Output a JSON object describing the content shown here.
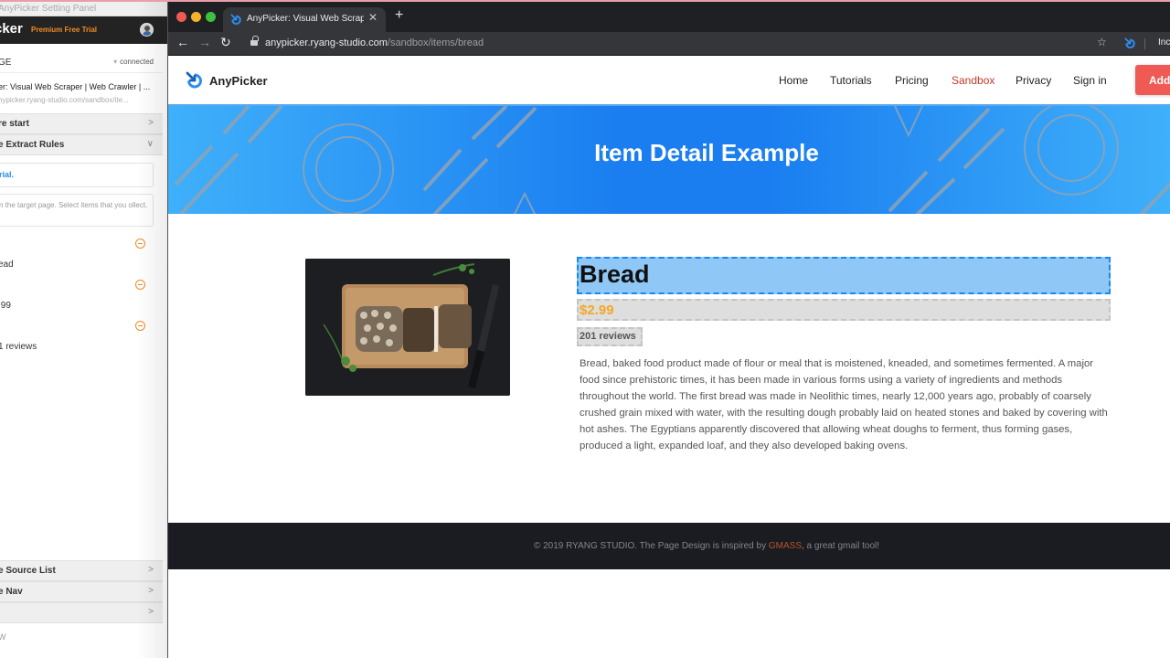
{
  "panel": {
    "window_title": "AnyPicker Setting Panel",
    "logo": "cker",
    "trial_badge": "Premium Free Trial",
    "page_label": "GE",
    "connection_status": "connected",
    "page_title": "er: Visual Web Scraper | Web Crawler | ...",
    "page_url": "nypicker.ryang-studio.com/sandbox/ite...",
    "sections": {
      "before_start": "re start",
      "extract_rules": "e Extract Rules",
      "source_list": "e Source List",
      "nav": "e Nav",
      "extra": ""
    },
    "tutorial_link": "rial.",
    "instructions": "n the target page. Select items that you ollect.",
    "fields": [
      {
        "value": "ead"
      },
      {
        "value": ".99"
      },
      {
        "value": "1 reviews"
      }
    ],
    "footer_text": "W"
  },
  "browser": {
    "tab_title": "AnyPicker: Visual Web Scraper |",
    "url_host": "anypicker.ryang-studio.com",
    "url_path": "/sandbox/items/bread",
    "profile_label": "Inc"
  },
  "site": {
    "brand": "AnyPicker",
    "nav": [
      {
        "label": "Home",
        "active": false
      },
      {
        "label": "Tutorials",
        "active": false
      },
      {
        "label": "Pricing",
        "active": false
      },
      {
        "label": "Sandbox",
        "active": true
      },
      {
        "label": "Privacy",
        "active": false
      },
      {
        "label": "Sign in",
        "active": false
      }
    ],
    "cta_label": "Add t",
    "hero_title": "Item Detail Example",
    "product": {
      "name": "Bread",
      "price": "$2.99",
      "reviews": "201 reviews",
      "image_alt": "bread loaf on cutting board",
      "description": "Bread, baked food product made of flour or meal that is moistened, kneaded, and sometimes fermented. A major food since prehistoric times, it has been made in various forms using a variety of ingredients and methods throughout the world. The first bread was made in Neolithic times, nearly 12,000 years ago, probably of coarsely crushed grain mixed with water, with the resulting dough probably laid on heated stones and baked by covering with hot ashes. The Egyptians apparently discovered that allowing wheat doughs to ferment, thus forming gases, produced a light, expanded loaf, and they also developed baking ovens."
    },
    "footer": {
      "prefix": "© 2019 RYANG STUDIO. The Page Design is inspired by ",
      "link": "GMASS",
      "suffix": ", a great gmail tool!"
    }
  },
  "colors": {
    "brand_blue": "#1a7ef0",
    "accent_red": "#ef5a55",
    "active_nav": "#c0392b",
    "price": "#f5a623",
    "selection_fill": "#8fc8f7",
    "selection_border": "#1a88ee",
    "panel_orange": "#f08a24"
  }
}
